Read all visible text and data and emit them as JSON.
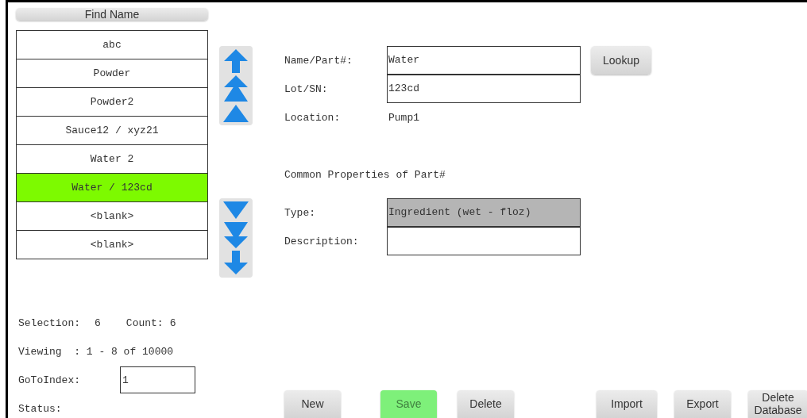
{
  "find_button": "Find Name",
  "list": [
    {
      "label": "abc",
      "selected": false
    },
    {
      "label": "Powder",
      "selected": false
    },
    {
      "label": "Powder2",
      "selected": false
    },
    {
      "label": "Sauce12 / xyz21",
      "selected": false
    },
    {
      "label": "Water 2",
      "selected": false
    },
    {
      "label": "Water / 123cd",
      "selected": true
    },
    {
      "label": "<blank>",
      "selected": false
    },
    {
      "label": "<blank>",
      "selected": false
    }
  ],
  "fields": [
    {
      "label": "Name/Part#:",
      "kind": "input",
      "value": "Water",
      "disabled": false
    },
    {
      "label": "Lot/SN:",
      "kind": "input",
      "value": "123cd",
      "disabled": false
    },
    {
      "label": "Location:",
      "kind": "text",
      "value": "Pump1",
      "disabled": false
    }
  ],
  "lookup_button": "Lookup",
  "section_title": "Common Properties of Part#",
  "properties": [
    {
      "label": "Type:",
      "kind": "input",
      "value": "Ingredient (wet - floz)",
      "disabled": true
    },
    {
      "label": "Description:",
      "kind": "input",
      "disabled": false
    }
  ],
  "stats": {
    "selection_label": "Selection:",
    "selection": "6",
    "count_label": "Count:",
    "count": "6",
    "viewing": "Viewing  : 1 - 8 of 10000"
  },
  "goto": {
    "label": "GoToIndex:",
    "value": "1"
  },
  "status_label": "Status:",
  "buttons": [
    {
      "label": "New",
      "disabled": false
    },
    {
      "label": "Save",
      "disabled": true
    },
    {
      "label": "Delete",
      "disabled": false
    },
    {
      "label": "Import",
      "disabled": false
    },
    {
      "label": "Export",
      "disabled": false
    },
    {
      "label": "Delete Database",
      "disabled": false
    }
  ]
}
